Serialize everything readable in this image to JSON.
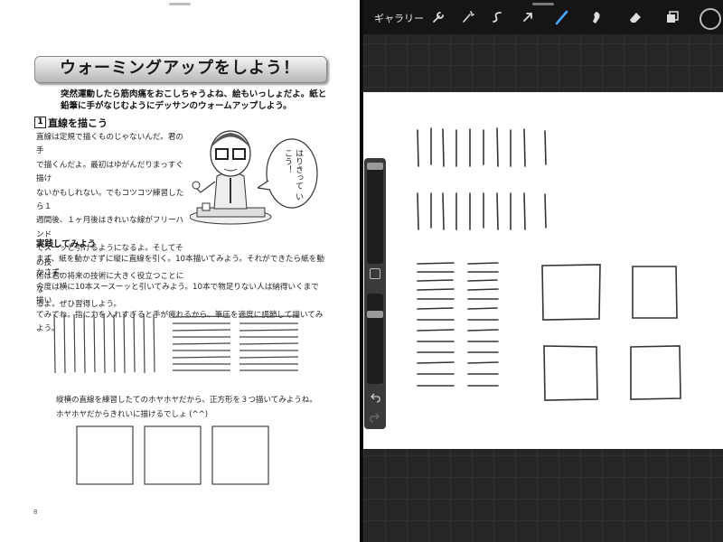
{
  "document": {
    "title": "ウォーミングアップをしよう！",
    "intro_lines": [
      "突然運動したら筋肉痛をおこしちゃうよね、絵もいっしょだよ。紙と",
      "鉛筆に手がなじむようにデッサンのウォームアップしよう。"
    ],
    "section_number": "1",
    "section_title": "直線を描こう",
    "body_lines": [
      "直線は定規で描くものじゃないんだ。君の手",
      "で描くんだよ。最初はゆがんだりまっすぐ描け",
      "ないかもしれない。でもコツコツ練習したら１",
      "週間後、１ヶ月後はきれいな線がフリーハンド",
      "でスーッと引けるようになるよ。そしてその技",
      "術は君の将来の技術に大きく役立つことにな",
      "るよ。ぜひ習得しよう。"
    ],
    "speech_bubble": "はりきって いこう！",
    "practice_title": "実践してみよう",
    "practice_lines": [
      "まず、紙を動かさずに縦に直線を引く。10本描いてみよう。それができたら紙を動かさず、",
      "今度は横に10本スースーッと引いてみよう。10本で物足りない人は納得いくまで描い",
      "てみてね。指に力を入れすぎると手が疲れるから、筆圧を適度に調節して描いてみよう。"
    ],
    "square_note_lines": [
      "縦横の直線を練習したてのホヤホヤだから、正方形を３つ描いてみようね。",
      "ホヤホヤだからきれいに描けるでしょ (^^)"
    ],
    "page_number": "8"
  },
  "app": {
    "gallery_label": "ギャラリー",
    "icons": [
      "wrench-icon",
      "magic-wand-icon",
      "selection-icon",
      "move-arrow-icon",
      "brush-icon",
      "smudge-icon",
      "eraser-icon",
      "layers-icon",
      "color-swatch-icon"
    ],
    "colors": {
      "accent": "#4aa3ff",
      "current_color": "#111111"
    }
  }
}
